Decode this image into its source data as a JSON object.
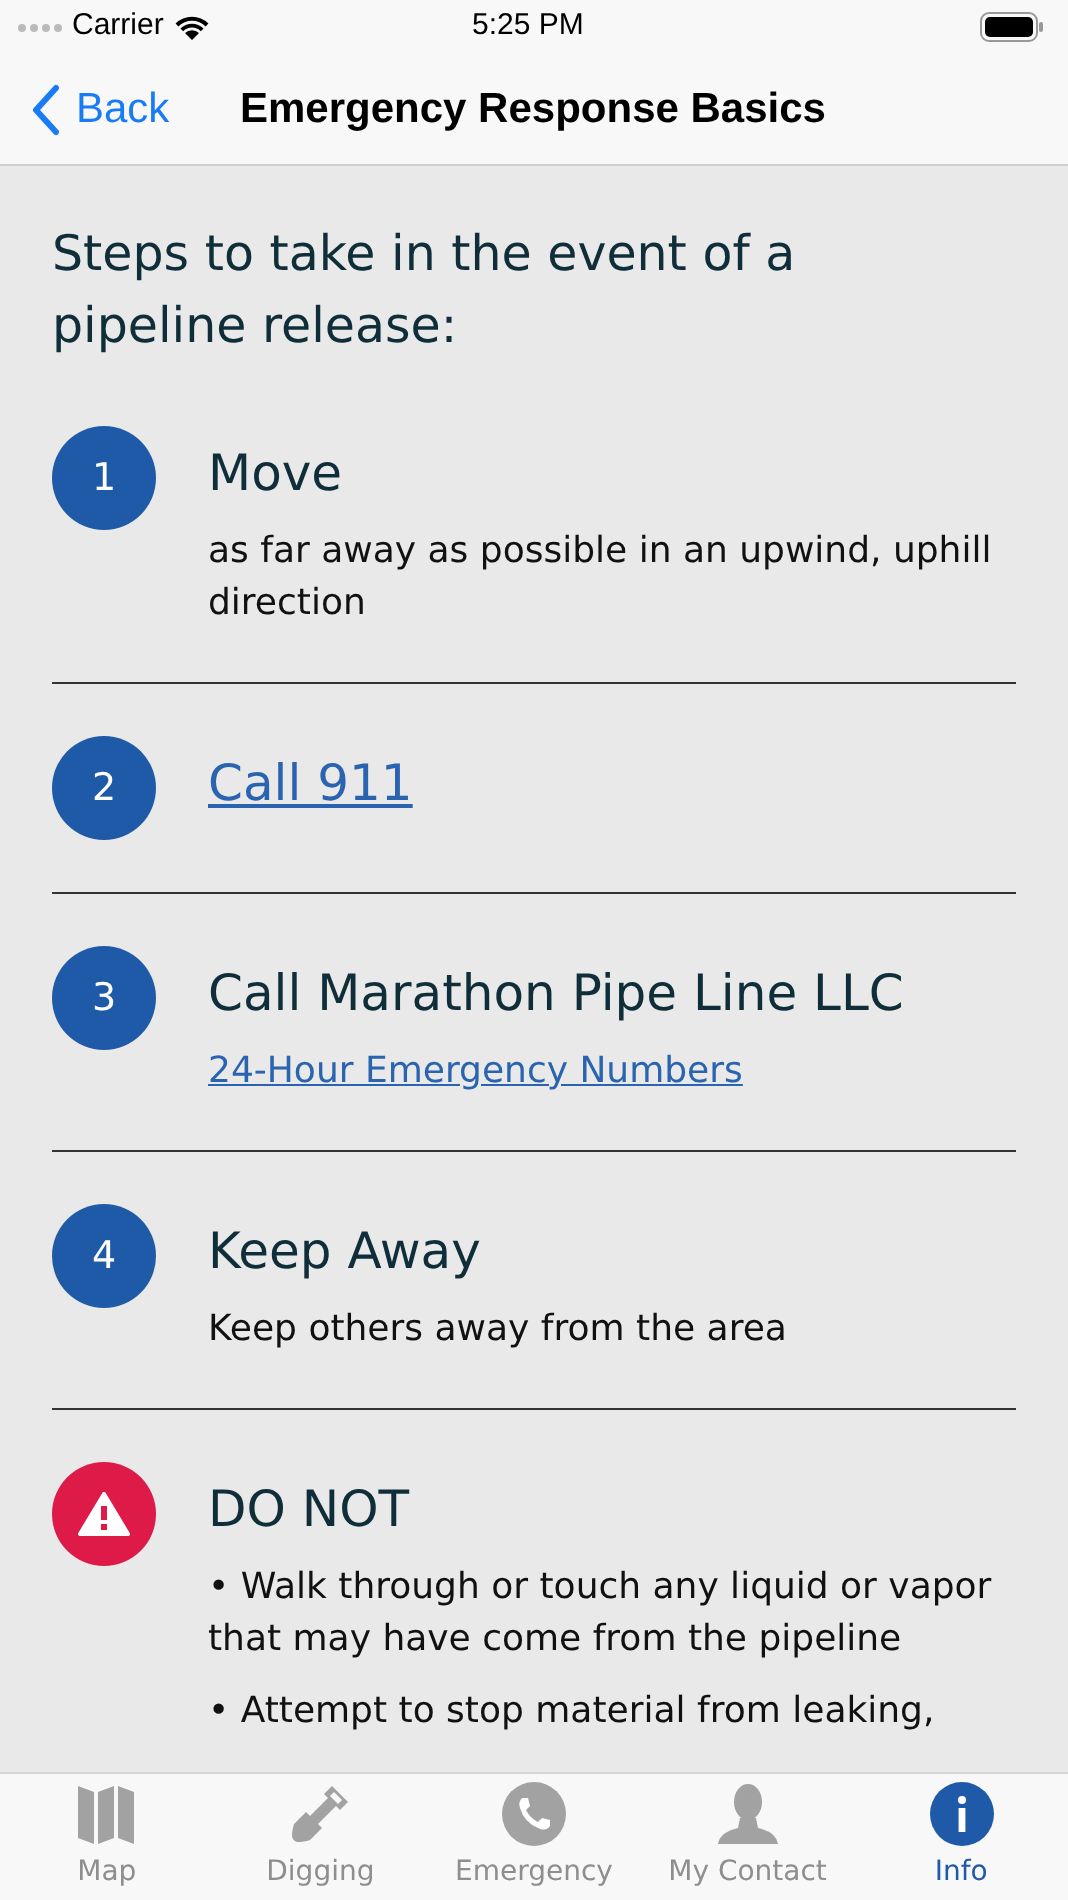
{
  "status_bar": {
    "carrier": "Carrier",
    "time": "5:25 PM"
  },
  "nav": {
    "back": "Back",
    "title": "Emergency Response Basics"
  },
  "intro": "Steps to take in the event of a pipeline release:",
  "steps": [
    {
      "kind": "number",
      "badge": "1",
      "title": "Move",
      "title_link": false,
      "details": [
        {
          "text": "as far away as possible in an upwind, uphill direction",
          "link": false
        }
      ]
    },
    {
      "kind": "number",
      "badge": "2",
      "title": "Call 911",
      "title_link": true
    },
    {
      "kind": "number",
      "badge": "3",
      "title": "Call Marathon Pipe Line LLC",
      "title_link": false,
      "details": [
        {
          "text": "24-Hour Emergency Numbers",
          "link": true
        }
      ]
    },
    {
      "kind": "number",
      "badge": "4",
      "title": "Keep Away",
      "title_link": false,
      "details": [
        {
          "text": "Keep others away from the area",
          "link": false
        }
      ]
    },
    {
      "kind": "warning",
      "title": "DO NOT",
      "title_link": false,
      "details": [
        {
          "text": "• Walk through or touch any liquid or vapor that may have come from the pipeline",
          "link": false
        },
        {
          "text": "• Attempt to stop material from leaking,",
          "link": false
        }
      ]
    }
  ],
  "tabs": [
    {
      "kind": "map",
      "label": "Map",
      "selected": false
    },
    {
      "kind": "shovel",
      "label": "Digging",
      "selected": false
    },
    {
      "kind": "phone",
      "label": "Emergency",
      "selected": false
    },
    {
      "kind": "person",
      "label": "My Contact",
      "selected": false
    },
    {
      "kind": "info",
      "label": "Info",
      "selected": true
    }
  ]
}
